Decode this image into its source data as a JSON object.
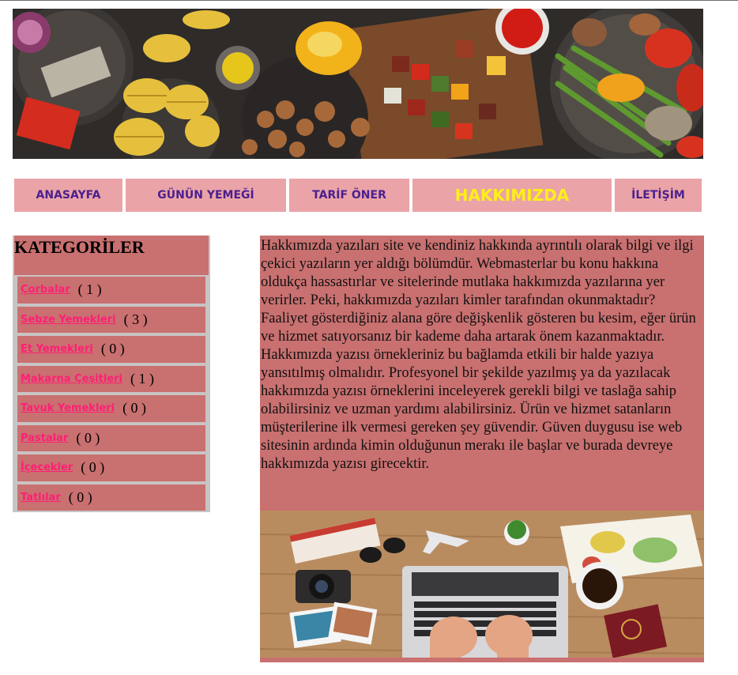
{
  "nav": {
    "items": [
      {
        "label": "ANASAYFA",
        "active": false
      },
      {
        "label": "GÜNÜN YEMEĞİ",
        "active": false
      },
      {
        "label": "TARİF ÖNER",
        "active": false
      },
      {
        "label": "HAKKIMIZDA",
        "active": true
      },
      {
        "label": "İLETİŞİM",
        "active": false
      }
    ]
  },
  "sidebar": {
    "title": "KATEGORİLER",
    "items": [
      {
        "label": "Çorbalar",
        "count": "( 1 )"
      },
      {
        "label": "Sebze Yemekleri",
        "count": "( 3 )"
      },
      {
        "label": "Et Yemekleri",
        "count": "( 0 )"
      },
      {
        "label": "Makarna Çeşitleri",
        "count": "( 1 )"
      },
      {
        "label": "Tavuk Yemekleri",
        "count": "( 0 )"
      },
      {
        "label": "Pastalar",
        "count": "( 0 )"
      },
      {
        "label": "İçecekler",
        "count": "( 0 )"
      },
      {
        "label": "Tatlılar",
        "count": "( 0 )"
      }
    ]
  },
  "main": {
    "about_text": "Hakkımızda yazıları site ve kendiniz hakkında ayrıntılı olarak bilgi ve ilgi çekici yazıların yer aldığı bölümdür. Webmasterlar bu konu hakkına oldukça hassastırlar ve sitelerinde mutlaka hakkımızda yazılarına yer verirler. Peki, hakkımızda yazıları kimler tarafından okunmaktadır? Faaliyet gösterdiğiniz alana göre değişkenlik gösteren bu kesim, eğer ürün ve hizmet satıyorsanız bir kademe daha artarak önem kazanmaktadır. Hakkımızda yazısı örnekleriniz bu bağlamda etkili bir halde yazıya yansıtılmış olmalıdır. Profesyonel bir şekilde yazılmış ya da yazılacak hakkımızda yazısı örneklerini inceleyerek gerekli bilgi ve taslağa sahip olabilirsiniz ve uzman yardımı alabilirsiniz. Ürün ve hizmet satanların müşterilerine ilk vermesi gereken şey güvendir. Güven duygusu ise web sitesinin ardında kimin olduğunun merakı ile başlar ve burada devreye hakkımızda yazısı girecektir."
  },
  "colors": {
    "nav_bg": "#eaa3a7",
    "nav_text": "#4b1f8f",
    "nav_active_text": "#ffef1a",
    "panel_bg": "#c97070",
    "link_color": "#ff1f75"
  }
}
